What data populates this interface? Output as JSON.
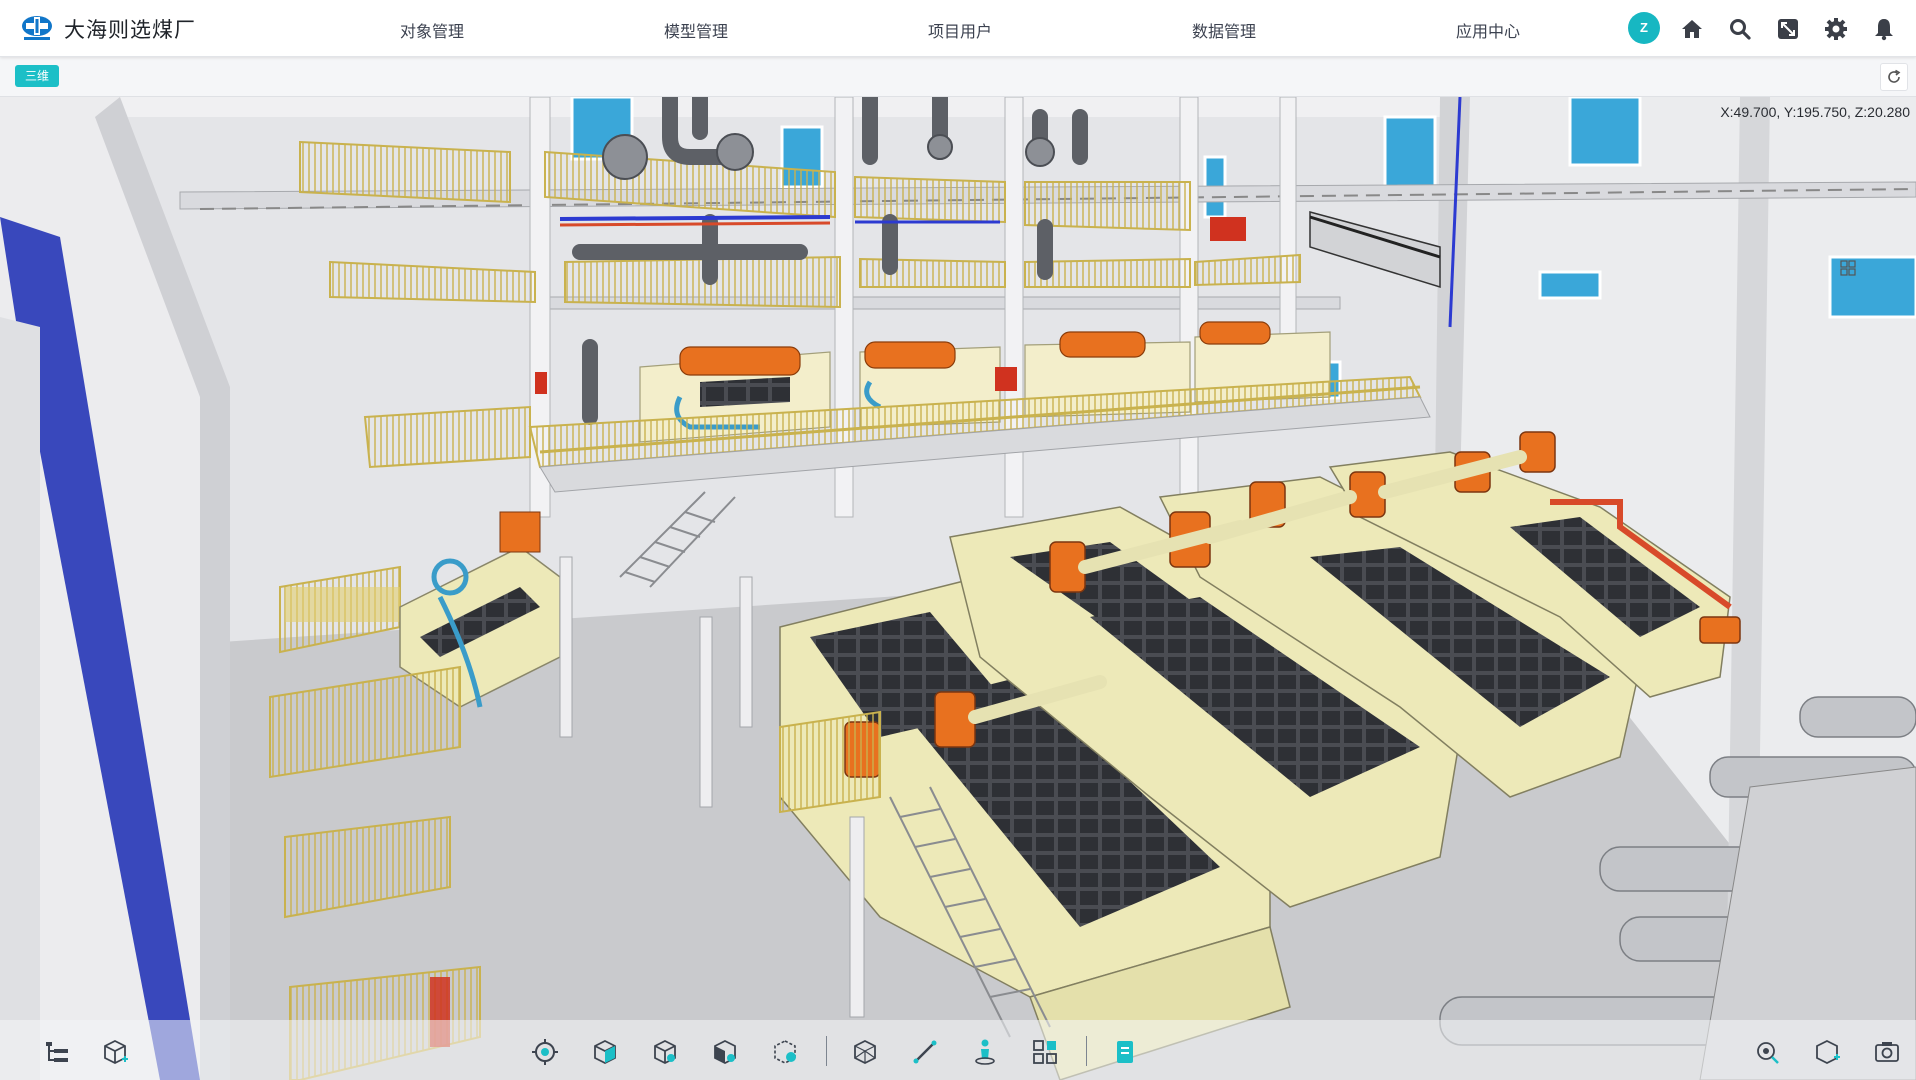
{
  "app": {
    "title": "大海则选煤厂"
  },
  "nav": [
    {
      "label": "对象管理"
    },
    {
      "label": "模型管理"
    },
    {
      "label": "项目用户"
    },
    {
      "label": "数据管理"
    },
    {
      "label": "应用中心"
    }
  ],
  "user": {
    "avatar_letter": "Z",
    "avatar_color": "#17b7c2"
  },
  "header_icons": [
    "home-icon",
    "search-icon",
    "fullscreen-icon",
    "settings-icon",
    "bell-icon"
  ],
  "view": {
    "tab_label": "三维",
    "coordinates": "X:49.700, Y:195.750, Z:20.280"
  },
  "colors": {
    "accent": "#1cbfc7",
    "equipment_body": "#ede9b8",
    "motor_orange": "#e8711f",
    "railing_yellow": "#d8c66a",
    "pipe_blue": "#3a9cc9"
  },
  "bottom_tools": [
    "tree-icon",
    "add-model-icon",
    "locate-icon",
    "cube-icon",
    "cube-pin-icon",
    "solid-pin-icon",
    "section-box-icon",
    "wireframe-cube-icon",
    "measure-icon",
    "roam-person-icon",
    "grid-view-icon",
    "document-icon",
    "camera-pin-icon",
    "model-pin-icon",
    "screenshot-icon"
  ]
}
